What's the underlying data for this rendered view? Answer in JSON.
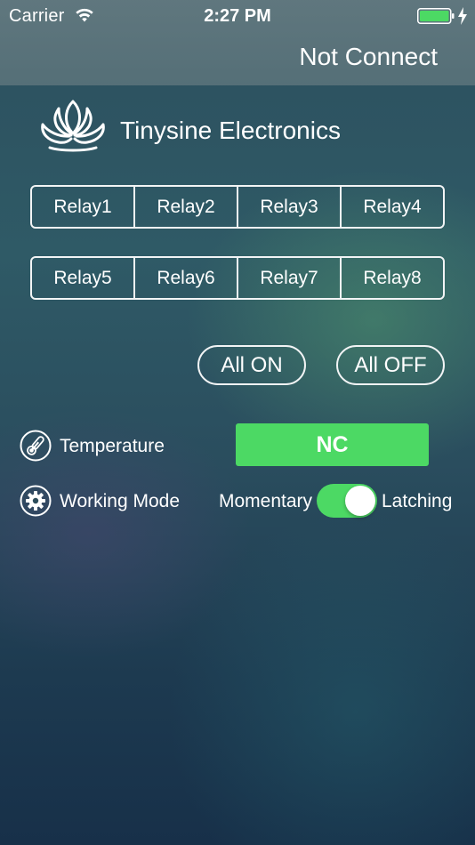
{
  "status_bar": {
    "carrier": "Carrier",
    "time": "2:27 PM"
  },
  "header": {
    "connection_status": "Not Connect"
  },
  "brand": {
    "name": "Tinysine Electronics"
  },
  "relays": {
    "row1": [
      "Relay1",
      "Relay2",
      "Relay3",
      "Relay4"
    ],
    "row2": [
      "Relay5",
      "Relay6",
      "Relay7",
      "Relay8"
    ]
  },
  "controls": {
    "all_on": "All ON",
    "all_off": "All OFF"
  },
  "temperature": {
    "label": "Temperature",
    "value": "NC"
  },
  "working_mode": {
    "label": "Working Mode",
    "left_option": "Momentary",
    "right_option": "Latching",
    "toggle_on": true
  },
  "icons": {
    "wifi": "wifi-icon",
    "battery": "battery-icon",
    "charging": "charging-icon",
    "lotus": "lotus-logo-icon",
    "thermometer": "thermometer-icon",
    "gear": "gear-icon"
  },
  "colors": {
    "accent_green": "#4cd964",
    "battery_green": "#4cd964"
  }
}
